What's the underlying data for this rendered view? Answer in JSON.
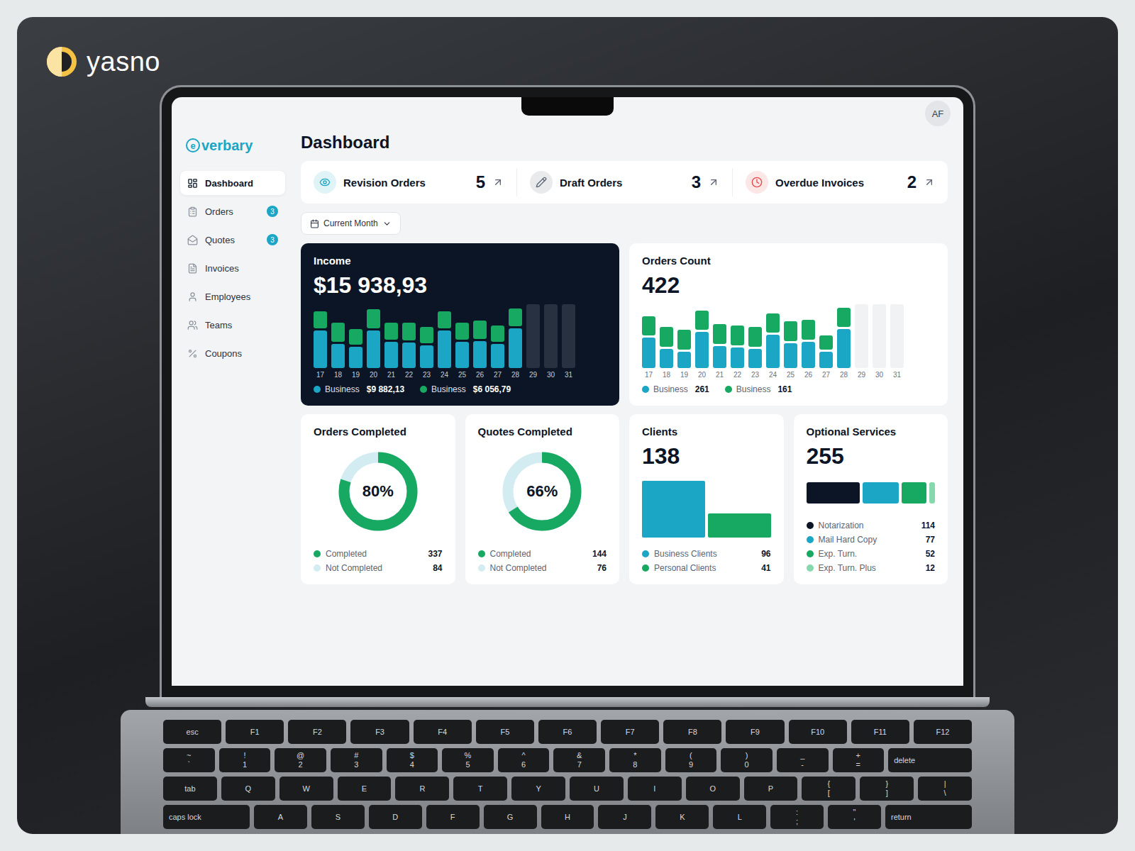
{
  "logo": {
    "text": "yasno"
  },
  "brand": {
    "mark": "e",
    "text": "verbary"
  },
  "user": {
    "initials": "AF"
  },
  "sidebar": {
    "items": [
      {
        "label": "Dashboard",
        "selected": true
      },
      {
        "label": "Orders",
        "selected": false,
        "badge": "3"
      },
      {
        "label": "Quotes",
        "selected": false,
        "badge": "3"
      },
      {
        "label": "Invoices",
        "selected": false
      },
      {
        "label": "Employees",
        "selected": false
      },
      {
        "label": "Teams",
        "selected": false
      },
      {
        "label": "Coupons",
        "selected": false
      }
    ]
  },
  "page_title": "Dashboard",
  "stats": [
    {
      "label": "Revision Orders",
      "count": "5",
      "color": "#1aa6c4"
    },
    {
      "label": "Draft Orders",
      "count": "3",
      "color": "#5b6472"
    },
    {
      "label": "Overdue Invoices",
      "count": "2",
      "color": "#e5484d"
    }
  ],
  "period": {
    "label": "Current Month"
  },
  "income": {
    "title": "Income",
    "total": "$15 938,93",
    "x_labels": [
      "17",
      "18",
      "19",
      "20",
      "21",
      "22",
      "23",
      "24",
      "25",
      "26",
      "27",
      "28",
      "29",
      "30",
      "31"
    ],
    "series": [
      {
        "name": "Business",
        "legend_value": "$9 882,13",
        "color": "#1aa6c4",
        "values": [
          1000,
          650,
          560,
          1010,
          700,
          680,
          600,
          1000,
          700,
          720,
          640,
          1050,
          null,
          null,
          null
        ]
      },
      {
        "name": "Business",
        "legend_value": "$6 056,79",
        "color": "#17a862",
        "values": [
          450,
          500,
          420,
          500,
          450,
          480,
          440,
          460,
          460,
          480,
          430,
          480,
          null,
          null,
          null
        ]
      }
    ]
  },
  "orders_count": {
    "title": "Orders Count",
    "total": "422",
    "x_labels": [
      "17",
      "18",
      "19",
      "20",
      "21",
      "22",
      "23",
      "24",
      "25",
      "26",
      "27",
      "28",
      "29",
      "30",
      "31"
    ],
    "series": [
      {
        "name": "Business",
        "legend_value": "261",
        "color": "#1aa6c4",
        "values": [
          22,
          14,
          12,
          26,
          16,
          15,
          14,
          24,
          18,
          19,
          12,
          28,
          null,
          null,
          null
        ]
      },
      {
        "name": "Business",
        "legend_value": "161",
        "color": "#17a862",
        "values": [
          14,
          14,
          14,
          14,
          14,
          14,
          14,
          14,
          14,
          14,
          10,
          14,
          null,
          null,
          null
        ]
      }
    ]
  },
  "orders_completed": {
    "title": "Orders Completed",
    "percent": "80%",
    "level": 0.8,
    "legend": [
      {
        "label": "Completed",
        "value": "337",
        "color": "#17a862"
      },
      {
        "label": "Not Completed",
        "value": "84",
        "color": "#d3ecf1"
      }
    ]
  },
  "quotes_completed": {
    "title": "Quotes Completed",
    "percent": "66%",
    "level": 0.66,
    "legend": [
      {
        "label": "Completed",
        "value": "144",
        "color": "#17a862"
      },
      {
        "label": "Not Completed",
        "value": "76",
        "color": "#d3ecf1"
      }
    ]
  },
  "clients": {
    "title": "Clients",
    "total": "138",
    "groups": [
      {
        "label": "Business Clients",
        "value": "96",
        "color": "#1aa6c4"
      },
      {
        "label": "Personal Clients",
        "value": "41",
        "color": "#17a862"
      }
    ]
  },
  "optional_services": {
    "title": "Optional Services",
    "total": "255",
    "items": [
      {
        "label": "Notarization",
        "value": "114",
        "color": "#0b1526"
      },
      {
        "label": "Mail Hard Copy",
        "value": "77",
        "color": "#1aa6c4"
      },
      {
        "label": "Exp. Turn.",
        "value": "52",
        "color": "#17a862"
      },
      {
        "label": "Exp. Turn. Plus",
        "value": "12",
        "color": "#86d9ad"
      }
    ]
  },
  "keyboard": {
    "rows": [
      [
        [
          "esc"
        ],
        [
          "F1"
        ],
        [
          "F2"
        ],
        [
          "F3"
        ],
        [
          "F4"
        ],
        [
          "F5"
        ],
        [
          "F6"
        ],
        [
          "F7"
        ],
        [
          "F8"
        ],
        [
          "F9"
        ],
        [
          "F10"
        ],
        [
          "F11"
        ],
        [
          "F12"
        ]
      ],
      [
        [
          "~",
          "`"
        ],
        [
          "!",
          "1"
        ],
        [
          "@",
          "2"
        ],
        [
          "#",
          "3"
        ],
        [
          "$",
          "4"
        ],
        [
          "%",
          "5"
        ],
        [
          "^",
          "6"
        ],
        [
          "&",
          "7"
        ],
        [
          "*",
          "8"
        ],
        [
          "(",
          "9"
        ],
        [
          ")",
          "0"
        ],
        [
          "_",
          "-"
        ],
        [
          "+",
          "="
        ],
        [
          "delete"
        ]
      ],
      [
        [
          "tab"
        ],
        [
          "Q"
        ],
        [
          "W"
        ],
        [
          "E"
        ],
        [
          "R"
        ],
        [
          "T"
        ],
        [
          "Y"
        ],
        [
          "U"
        ],
        [
          "I"
        ],
        [
          "O"
        ],
        [
          "P"
        ],
        [
          "{",
          "["
        ],
        [
          "}",
          "]"
        ],
        [
          "|",
          "\\"
        ]
      ],
      [
        [
          "caps lock"
        ],
        [
          "A"
        ],
        [
          "S"
        ],
        [
          "D"
        ],
        [
          "F"
        ],
        [
          "G"
        ],
        [
          "H"
        ],
        [
          "J"
        ],
        [
          "K"
        ],
        [
          "L"
        ],
        [
          ":",
          ";"
        ],
        [
          "\"",
          "'"
        ],
        [
          "return"
        ]
      ]
    ]
  }
}
